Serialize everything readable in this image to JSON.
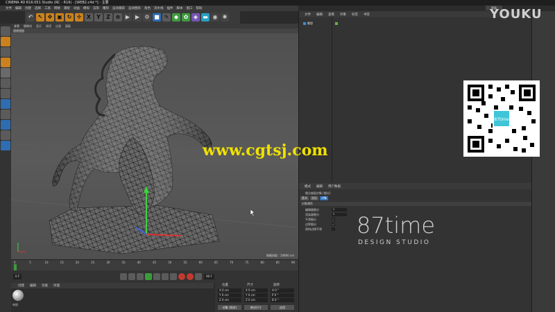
{
  "window": {
    "title": "CINEMA 4D R16.051 Studio (RC - R16) - [WEB2.c4d *] - 主要"
  },
  "menubar": [
    "文件",
    "编辑",
    "创建",
    "选择",
    "工具",
    "网格",
    "捕捉",
    "动画",
    "模拟",
    "渲染",
    "雕刻",
    "运动跟踪",
    "运动图形",
    "角色",
    "流水线",
    "插件",
    "脚本",
    "窗口",
    "帮助"
  ],
  "toolbar": {
    "buttons": [
      {
        "name": "undo-icon",
        "glyph": "↶",
        "tone": "dark"
      },
      {
        "name": "select-icon",
        "glyph": "↖",
        "tone": "orange"
      },
      {
        "name": "move-icon",
        "glyph": "✥",
        "tone": "orange"
      },
      {
        "name": "scale-icon",
        "glyph": "▣",
        "tone": "orange"
      },
      {
        "name": "rotate-icon",
        "glyph": "↻",
        "tone": "orange"
      },
      {
        "name": "axis-icon",
        "glyph": "✛",
        "tone": "orange"
      },
      {
        "name": "x-axis-icon",
        "glyph": "X",
        "tone": "plain"
      },
      {
        "name": "y-axis-icon",
        "glyph": "Y",
        "tone": "plain"
      },
      {
        "name": "z-axis-icon",
        "glyph": "Z",
        "tone": "plain"
      },
      {
        "name": "coord-icon",
        "glyph": "⊕",
        "tone": "plain"
      },
      {
        "name": "render-view-icon",
        "glyph": "▶",
        "tone": "dark"
      },
      {
        "name": "render-pv-icon",
        "glyph": "▶",
        "tone": "dark"
      },
      {
        "name": "render-settings-icon",
        "glyph": "⚙",
        "tone": "dark"
      },
      {
        "name": "cube-icon",
        "glyph": "■",
        "tone": "blue"
      },
      {
        "name": "pen-icon",
        "glyph": "✎",
        "tone": "plain"
      },
      {
        "name": "subdivision-icon",
        "glyph": "◆",
        "tone": "green"
      },
      {
        "name": "array-icon",
        "glyph": "✿",
        "tone": "green"
      },
      {
        "name": "deformer-icon",
        "glyph": "◈",
        "tone": "purple"
      },
      {
        "name": "floor-icon",
        "glyph": "▬",
        "tone": "cyan"
      },
      {
        "name": "camera-icon",
        "glyph": "◉",
        "tone": "dark"
      },
      {
        "name": "light-icon",
        "glyph": "✺",
        "tone": "dark"
      }
    ]
  },
  "viewport": {
    "menu": [
      "查看",
      "摄像机",
      "显示",
      "选项",
      "过滤",
      "面板"
    ],
    "label": "透视视图",
    "grid_info": "网格间距 : 10000 cm",
    "watermark_url": "www.cgtsj.com"
  },
  "timeline": {
    "ticks": [
      "0",
      "5",
      "10",
      "15",
      "20",
      "25",
      "30",
      "35",
      "40",
      "45",
      "50",
      "55",
      "60",
      "65",
      "70",
      "75",
      "80",
      "85",
      "90"
    ],
    "frame_start": "0 F",
    "frame_end": "90 F",
    "current": "0 F"
  },
  "material_manager": {
    "menu": [
      "创建",
      "编辑",
      "功能",
      "纹理"
    ],
    "material_name": "材质"
  },
  "coordinates": {
    "headers": [
      "位置",
      "尺寸",
      "旋转"
    ],
    "rows": [
      {
        "pos": "X 0 cm",
        "size": "X 0 cm",
        "rot": "H 0 °"
      },
      {
        "pos": "Y 0 cm",
        "size": "Y 0 cm",
        "rot": "P 0 °"
      },
      {
        "pos": "Z 0 cm",
        "size": "Z 0 cm",
        "rot": "B 0 °"
      }
    ],
    "mode_select": "对象 (相对)",
    "size_select": "绝对尺寸",
    "apply_button": "应用"
  },
  "object_manager": {
    "menu": [
      "文件",
      "编辑",
      "查看",
      "对象",
      "标签",
      "书签"
    ],
    "objects": [
      {
        "name": "雕塑"
      }
    ]
  },
  "attribute_manager": {
    "menu": [
      "模式",
      "编辑",
      "用户数据"
    ],
    "object_title": "细分曲面对象 [细分]",
    "tabs": [
      "基本",
      "坐标",
      "对象"
    ],
    "section": "对象属性",
    "fields": [
      {
        "label": "编辑器细分",
        "value": "2"
      },
      {
        "label": "渲染器细分",
        "value": "2"
      }
    ],
    "checks": [
      {
        "label": "平滑细分",
        "checked": true
      },
      {
        "label": "边界细分",
        "checked": true
      },
      {
        "label": "保持边缘平滑",
        "checked": false
      }
    ]
  },
  "layout": {
    "label": "界面"
  },
  "overlays": {
    "youku": "YOUKU",
    "brand": "87time",
    "brand_sub": "DESIGN STUDIO",
    "qr_center": "87time"
  }
}
